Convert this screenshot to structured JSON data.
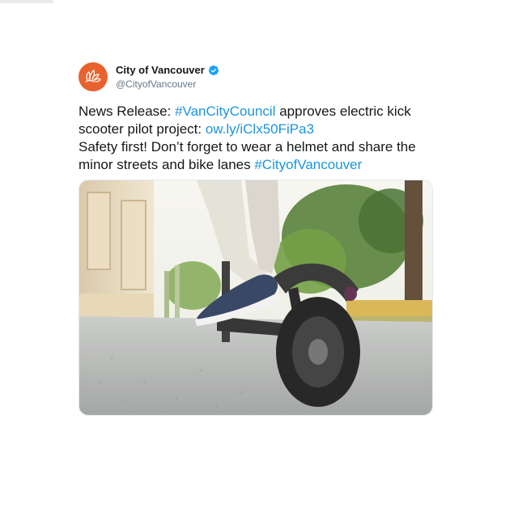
{
  "user": {
    "display_name": "City of Vancouver",
    "handle": "@CityofVancouver",
    "verified": true,
    "avatar_icon": "vancouver-flower-logo",
    "avatar_color": "#e8622d"
  },
  "tweet": {
    "segments": [
      {
        "text": "News Release: ",
        "kind": "text"
      },
      {
        "text": "#VanCityCouncil",
        "kind": "hashtag"
      },
      {
        "text": " approves electric kick scooter pilot project: ",
        "kind": "text"
      },
      {
        "text": "ow.ly/iClx50FiPa3",
        "kind": "link"
      },
      {
        "text": "\nSafety first! Don’t forget to wear a helmet and share the minor streets and bike lanes ",
        "kind": "text"
      },
      {
        "text": "#CityofVancouver",
        "kind": "hashtag"
      }
    ]
  },
  "media": {
    "type": "photo",
    "subject": "person riding electric kick scooter"
  },
  "colors": {
    "link": "#1b95e0",
    "text": "#14171a",
    "secondary": "#657786",
    "verified": "#1da1f2"
  }
}
